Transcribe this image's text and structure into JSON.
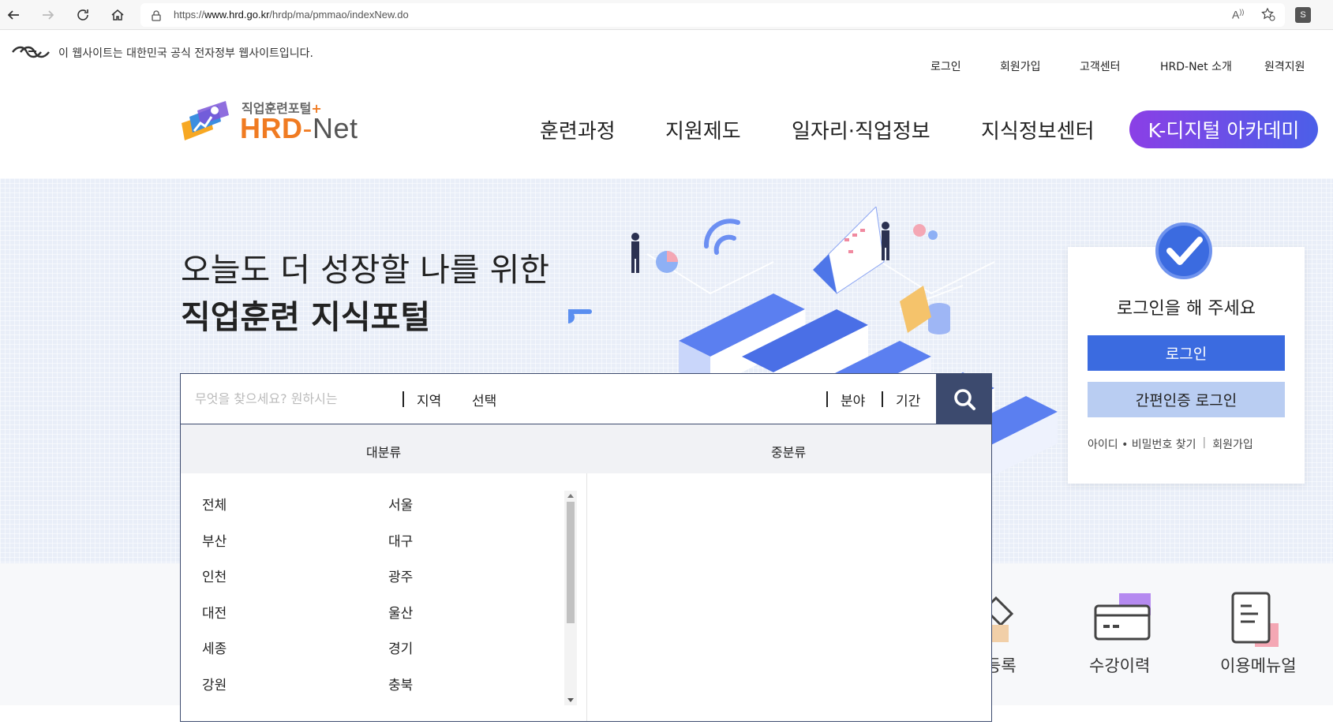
{
  "browser": {
    "url_prefix": "https://",
    "url_host": "www.hrd.go.kr",
    "url_path": "/hrdp/ma/pmmao/indexNew.do",
    "profile_initial": "S"
  },
  "gov_notice": "이 웹사이트는 대한민국 공식 전자정부 웹사이트입니다.",
  "top_links": [
    "로그인",
    "회원가입",
    "고객센터",
    "HRD-Net 소개",
    "원격지원"
  ],
  "logo": {
    "sub": "직업훈련포털",
    "plus": "+",
    "main_hrd": "HRD",
    "main_dash": "-",
    "main_net": "Net"
  },
  "gnb": [
    "훈련과정",
    "지원제도",
    "일자리·직업정보",
    "지식정보센터"
  ],
  "kdigital": "K-디지털 아카데미",
  "hero": {
    "line1": "오늘도 더 성장할 나를 위한",
    "line2": "직업훈련 지식포털"
  },
  "search": {
    "placeholder": "무엇을 찾으세요? 원하시는",
    "region_label": "지역",
    "region_value": "선택",
    "field_label": "분야",
    "period_label": "기간"
  },
  "dropdown": {
    "col1_header": "대분류",
    "col2_header": "중분류",
    "regions": [
      "전체",
      "서울",
      "부산",
      "대구",
      "인천",
      "광주",
      "대전",
      "울산",
      "세종",
      "경기",
      "강원",
      "충북"
    ]
  },
  "login_card": {
    "title": "로그인을 해 주세요",
    "login_button": "로그인",
    "simple_button": "간편인증 로그인",
    "find_link": "아이디 • 비밀번호 찾기",
    "separator": "|",
    "join_link": "회원가입"
  },
  "quick_menu": [
    "등록",
    "수강이력",
    "이용메뉴얼"
  ],
  "colors": {
    "primary": "#3b6be0",
    "navy": "#3c4a6e",
    "accent_orange": "#f07b22",
    "kdigital_start": "#8b3fe6",
    "kdigital_end": "#4b5fe8"
  }
}
